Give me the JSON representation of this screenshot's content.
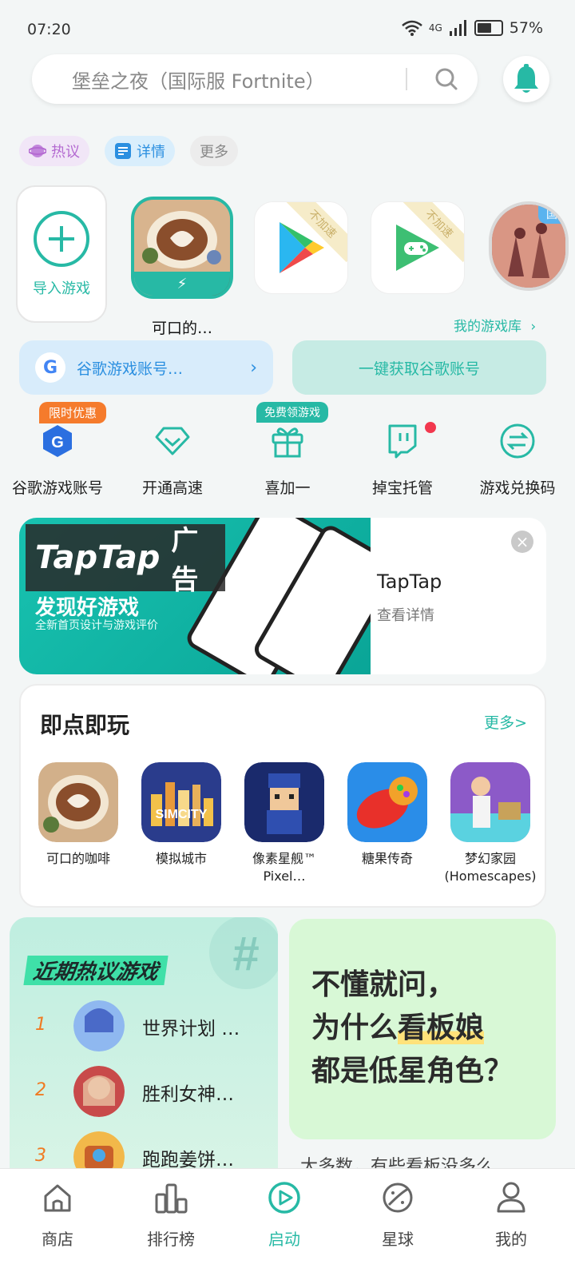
{
  "status_bar": {
    "time": "07:20",
    "network": "4G",
    "battery": "57%"
  },
  "search": {
    "placeholder": "堡垒之夜（国际服 Fortnite）"
  },
  "chips": [
    {
      "label": "热议",
      "color": "#b46ad1"
    },
    {
      "label": "详情",
      "color": "#2b8fe0"
    },
    {
      "label": "更多",
      "color": "#888888"
    }
  ],
  "games": {
    "import_label": "导入游戏",
    "selected_game_label": "可口的…",
    "no_accel_tag": "不加速",
    "intl_badge": "国",
    "my_library": "我的游戏库"
  },
  "google": {
    "account_label": "谷歌游戏账号…",
    "fetch_label": "一键获取谷歌账号"
  },
  "quick_actions": [
    {
      "label": "谷歌游戏账号",
      "tag": "限时优惠",
      "icon": "google-shield-icon"
    },
    {
      "label": "开通高速",
      "icon": "diamond-icon"
    },
    {
      "label": "喜加一",
      "tag": "免费领游戏",
      "icon": "gift-icon"
    },
    {
      "label": "掉宝托管",
      "icon": "twitch-icon"
    },
    {
      "label": "游戏兑换码",
      "icon": "exchange-icon"
    }
  ],
  "ad": {
    "brand": "TapTap",
    "ad_label": "广告",
    "slogan": "发现好游戏",
    "subtitle": "全新首页设计与游戏评价",
    "title": "TapTap",
    "detail": "查看详情",
    "close": "×"
  },
  "instant_play": {
    "title": "即点即玩",
    "more": "更多>",
    "games": [
      {
        "name": "可口的咖啡"
      },
      {
        "name": "模拟城市"
      },
      {
        "name": "像素星舰™ Pixel…"
      },
      {
        "name": "糖果传奇"
      },
      {
        "name": "梦幻家园 (Homescapes)"
      }
    ]
  },
  "trending": {
    "title": "近期热议游戏",
    "items": [
      {
        "rank": "1",
        "name": "世界计划 …"
      },
      {
        "rank": "2",
        "name": "胜利女神…"
      },
      {
        "rank": "3",
        "name": "跑跑姜饼…"
      }
    ]
  },
  "question": {
    "line1": "不懂就问，",
    "line2_pre": "为什么",
    "line2_hl": "看板娘",
    "line3": "都是低星角色？",
    "peek": "大多数，有些看板没多么"
  },
  "bottom_nav": [
    {
      "label": "商店",
      "icon": "home-icon"
    },
    {
      "label": "排行榜",
      "icon": "ranking-icon"
    },
    {
      "label": "启动",
      "icon": "play-icon",
      "active": true
    },
    {
      "label": "星球",
      "icon": "planet-icon"
    },
    {
      "label": "我的",
      "icon": "profile-icon"
    }
  ],
  "colors": {
    "accent": "#27b9a5",
    "blue": "#2b8fe0",
    "orange": "#f57b2c"
  }
}
